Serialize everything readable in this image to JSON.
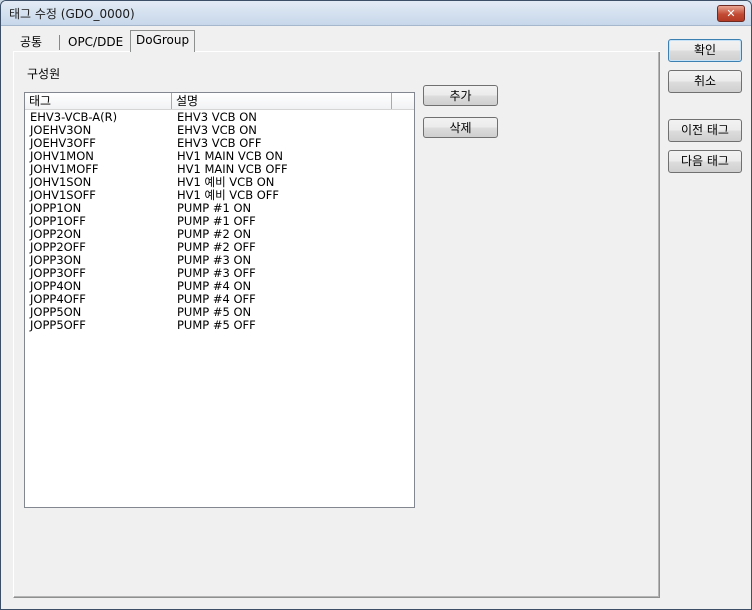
{
  "window": {
    "title": "태그 수정 (GDO_0000)",
    "close_glyph": "✕"
  },
  "tabs": [
    {
      "label": "공통"
    },
    {
      "label": "OPC/DDE"
    },
    {
      "label": "DoGroup"
    }
  ],
  "group": {
    "label": "구성원"
  },
  "list": {
    "columns": [
      "태그",
      "설명"
    ],
    "rows": [
      [
        "EHV3-VCB-A(R)",
        "EHV3 VCB ON"
      ],
      [
        "JOEHV3ON",
        "EHV3 VCB ON"
      ],
      [
        "JOEHV3OFF",
        "EHV3 VCB OFF"
      ],
      [
        "JOHV1MON",
        "HV1 MAIN VCB ON"
      ],
      [
        "JOHV1MOFF",
        "HV1 MAIN VCB OFF"
      ],
      [
        "JOHV1SON",
        "HV1 예비 VCB ON"
      ],
      [
        "JOHV1SOFF",
        "HV1 예비 VCB OFF"
      ],
      [
        "JOPP1ON",
        "PUMP #1 ON"
      ],
      [
        "JOPP1OFF",
        "PUMP #1 OFF"
      ],
      [
        "JOPP2ON",
        "PUMP #2 ON"
      ],
      [
        "JOPP2OFF",
        "PUMP #2 OFF"
      ],
      [
        "JOPP3ON",
        "PUMP #3 ON"
      ],
      [
        "JOPP3OFF",
        "PUMP #3 OFF"
      ],
      [
        "JOPP4ON",
        "PUMP #4 ON"
      ],
      [
        "JOPP4OFF",
        "PUMP #4 OFF"
      ],
      [
        "JOPP5ON",
        "PUMP #5 ON"
      ],
      [
        "JOPP5OFF",
        "PUMP #5 OFF"
      ]
    ]
  },
  "buttons": {
    "add": "추가",
    "delete": "삭제",
    "ok": "확인",
    "cancel": "취소",
    "prev_tag": "이전 태그",
    "next_tag": "다음 태그"
  }
}
